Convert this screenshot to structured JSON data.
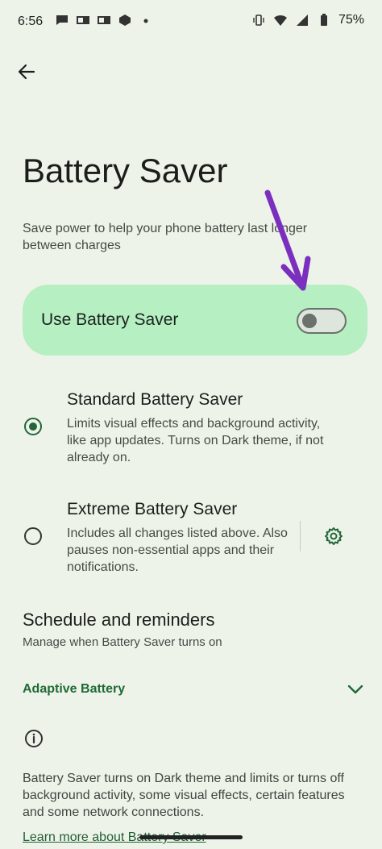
{
  "status_bar": {
    "time": "6:56",
    "battery_percent": "75%",
    "left_icons": [
      "chat-icon",
      "outlook-icon",
      "outlook-icon",
      "cube-icon",
      "dot-icon"
    ],
    "right_icons": [
      "vibrate-icon",
      "wifi-icon",
      "signal-icon",
      "battery-icon"
    ]
  },
  "header": {
    "title": "Battery Saver"
  },
  "intro": {
    "description": "Save power to help your phone battery last longer between charges"
  },
  "use_saver": {
    "label": "Use Battery Saver",
    "enabled": false
  },
  "options": [
    {
      "title": "Standard Battery Saver",
      "description": "Limits visual effects and background activity, like app updates. Turns on Dark theme, if not already on.",
      "selected": true
    },
    {
      "title": "Extreme Battery Saver",
      "description": "Includes all changes listed above. Also pauses non-essential apps and their notifications.",
      "selected": false
    }
  ],
  "schedule": {
    "title": "Schedule and reminders",
    "subtitle": "Manage when Battery Saver turns on"
  },
  "adaptive": {
    "label": "Adaptive Battery"
  },
  "footer": {
    "text": "Battery Saver turns on Dark theme and limits or turns off background activity, some visual effects, certain features and some network connections.",
    "learn_more": "Learn more about Battery Saver"
  },
  "colors": {
    "accent": "#23663a",
    "card": "#b5efc2",
    "annotation_arrow": "#7b2fbf"
  }
}
